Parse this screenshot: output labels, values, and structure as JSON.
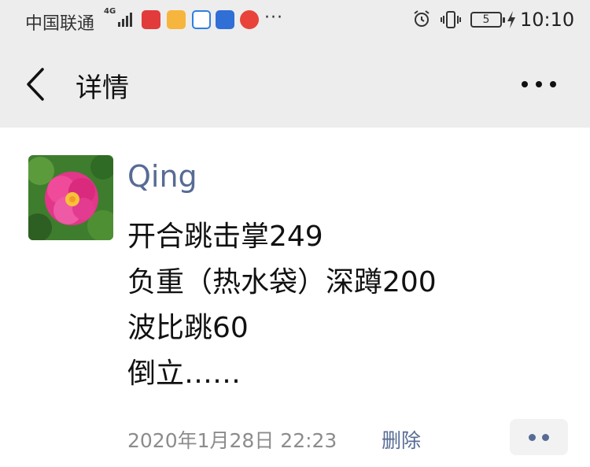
{
  "status_bar": {
    "carrier": "中国联通",
    "network": "4G",
    "more": "···",
    "battery": "5",
    "time": "10:10"
  },
  "nav": {
    "title": "详情"
  },
  "post": {
    "author": "Qing",
    "content_lines": [
      "开合跳击掌249",
      "负重（热水袋）深蹲200",
      "波比跳60",
      "倒立……"
    ],
    "timestamp": "2020年1月28日 22:23",
    "delete_label": "删除"
  },
  "colors": {
    "link": "#576b95",
    "bar_bg": "#ededed",
    "meta_text": "#8c8c8c"
  },
  "icons": [
    "back-arrow-icon",
    "more-icon",
    "alarm-icon",
    "vibrate-icon",
    "battery-icon",
    "charging-icon",
    "signal-icon",
    "comment-icon"
  ]
}
